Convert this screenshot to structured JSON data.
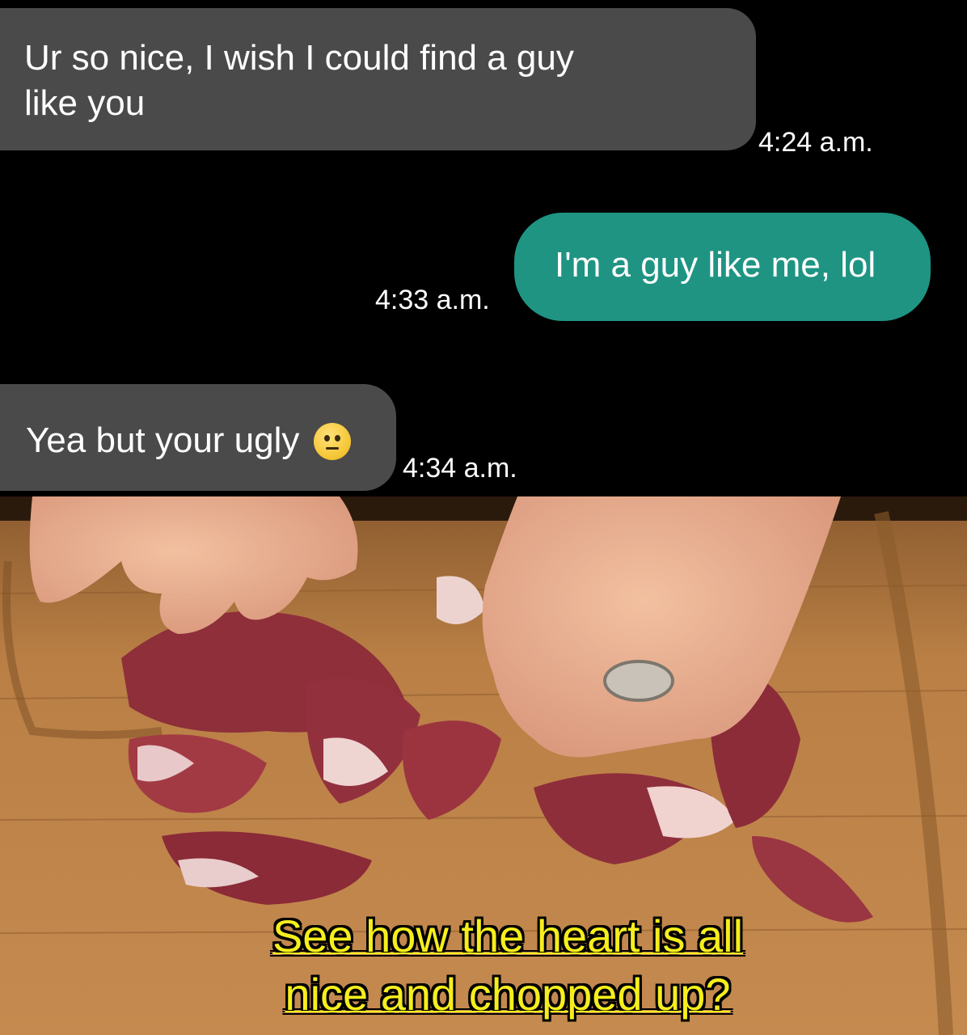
{
  "chat": {
    "messages": [
      {
        "text": "Ur so nice, I wish I could find a guy like you",
        "time": "4:24 a.m.",
        "direction": "received"
      },
      {
        "text": "I'm a guy like me, lol",
        "time": "4:33 a.m.",
        "direction": "sent"
      },
      {
        "text": "Yea but your ugly",
        "emoji": "neutral-face-icon",
        "time": "4:34 a.m.",
        "direction": "received"
      }
    ]
  },
  "photo": {
    "caption_line1": "See how the heart is all",
    "caption_line2": "nice and chopped up?"
  },
  "colors": {
    "received_bubble": "#4a4a4a",
    "sent_bubble": "#1f9483",
    "caption": "#f6ee1c",
    "board": "#b97f45"
  }
}
